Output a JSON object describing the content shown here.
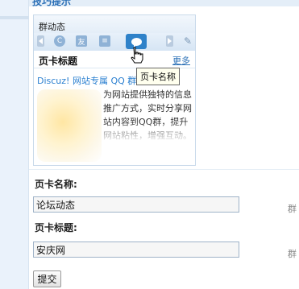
{
  "page": {
    "header_title": "技巧提示"
  },
  "preview": {
    "title": "群动态",
    "toolbar_icons": [
      "prev-arrow-icon",
      "refresh-icon",
      "friend-icon",
      "list-icon",
      "chat-bubble-icon",
      "next-arrow-icon",
      "wrench-icon"
    ],
    "tab_title": "页卡标题",
    "more_link": "更多",
    "headline": "Discuz! 网站专属 QQ 群",
    "body_text": "为网站提供独特的信息推广方式，实时分享网站内容到QQ群，提升网站粘性，增强互动。"
  },
  "tooltip": {
    "text": "页卡名称"
  },
  "form": {
    "name_label": "页卡名称:",
    "name_value": "论坛动态",
    "name_hint": "群",
    "title_label": "页卡标题:",
    "title_value": "安庆网",
    "title_hint": "群",
    "submit_label": "提交"
  }
}
